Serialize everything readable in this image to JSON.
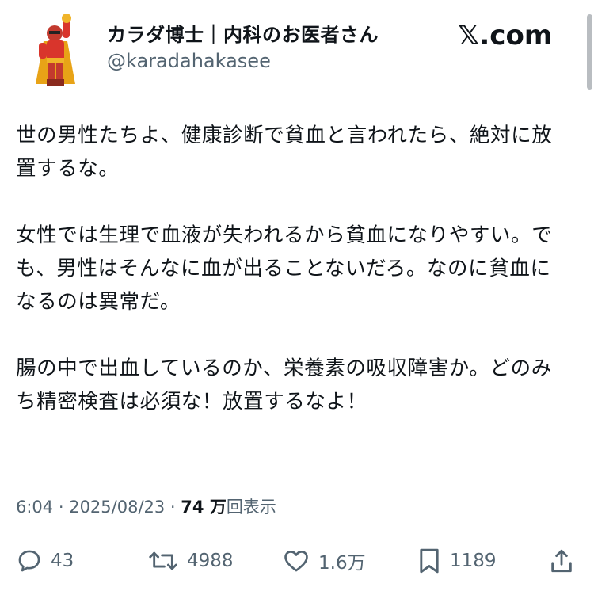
{
  "author": {
    "display_name": "カラダ博士｜内科のお医者さん",
    "handle": "@karadahakasee"
  },
  "brand": "𝕏.com",
  "post": {
    "paragraphs": [
      "世の男性たちよ、健康診断で貧血と言われたら、絶対に放置するな。",
      "女性では生理で血液が失われるから貧血になりやすい。でも、男性はそんなに血が出ることないだろ。なのに貧血になるのは異常だ。",
      "腸の中で出血しているのか、栄養素の吸収障害か。どのみち精密検査は必須な！放置するなよ！"
    ]
  },
  "meta": {
    "time": "6:04",
    "separator": " · ",
    "date": "2025/08/23",
    "separator2": " · ",
    "views_count": "74 万",
    "views_label": "回表示"
  },
  "actions": {
    "replies": "43",
    "reposts": "4988",
    "likes": "1.6万",
    "bookmarks": "1189"
  },
  "icons": {
    "reply": "speech-bubble",
    "repost": "repost-arrows",
    "like": "heart",
    "bookmark": "bookmark",
    "share": "share-upload"
  },
  "colors": {
    "text": "#0f1419",
    "secondary": "#536471"
  }
}
